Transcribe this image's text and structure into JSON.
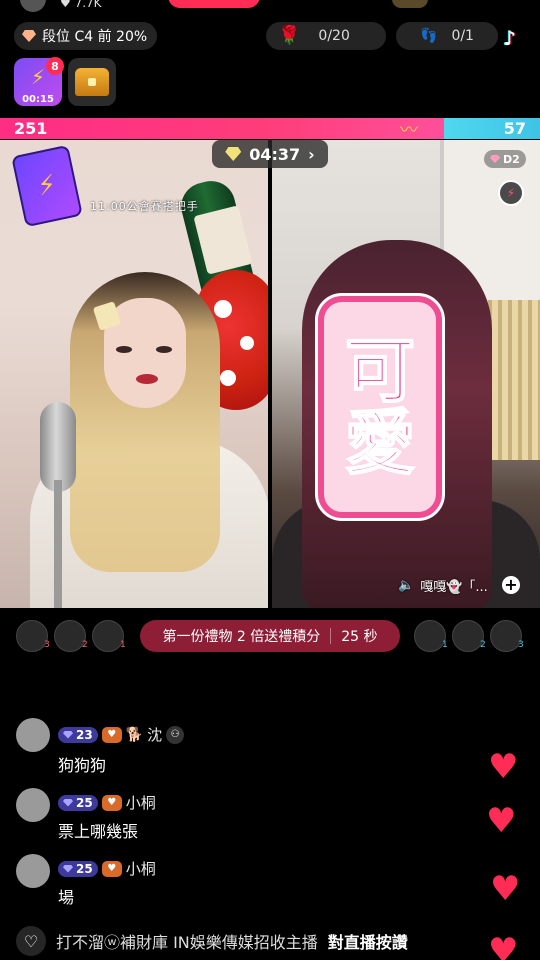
{
  "top": {
    "likes": "7.7K"
  },
  "rank": {
    "label": "段位 C4 前 20%"
  },
  "stats": {
    "roses": "0/20",
    "footprints": "0/1"
  },
  "boosters": {
    "count": "8",
    "timer": "00:15"
  },
  "battle": {
    "left_score": "251",
    "right_score": "57",
    "timer": "04:37",
    "chevron": "›"
  },
  "left_stream": {
    "overlay": "11:00公會賽搭把手"
  },
  "right_stream": {
    "badge": "D2",
    "sticker_line1": "可",
    "sticker_line2": "愛",
    "host_label": "嘎嘎👻「...",
    "plus": "+"
  },
  "supporters": {
    "left_ranks": [
      "3",
      "2",
      "1"
    ],
    "right_ranks": [
      "1",
      "2",
      "3"
    ]
  },
  "promo": {
    "text": "第一份禮物 2 倍送禮積分",
    "seconds": "25 秒"
  },
  "comments": [
    {
      "level": "23",
      "badge": "♥",
      "name": "沈",
      "text": "狗狗狗"
    },
    {
      "level": "25",
      "badge": "♥",
      "name": "小桐",
      "text": "票上哪幾張"
    },
    {
      "level": "25",
      "badge": "♥",
      "name": "小桐",
      "text": "場"
    }
  ],
  "bottom": {
    "prefix": "打不溜ⓦ補財庫 IN娛樂傳媒招收主播",
    "action": "對直播按讚"
  },
  "colors": {
    "accent": "#ff2d55",
    "left_team": "#ff2d85",
    "right_team": "#3fc3e6",
    "level_badge": "#3e3a9c"
  }
}
